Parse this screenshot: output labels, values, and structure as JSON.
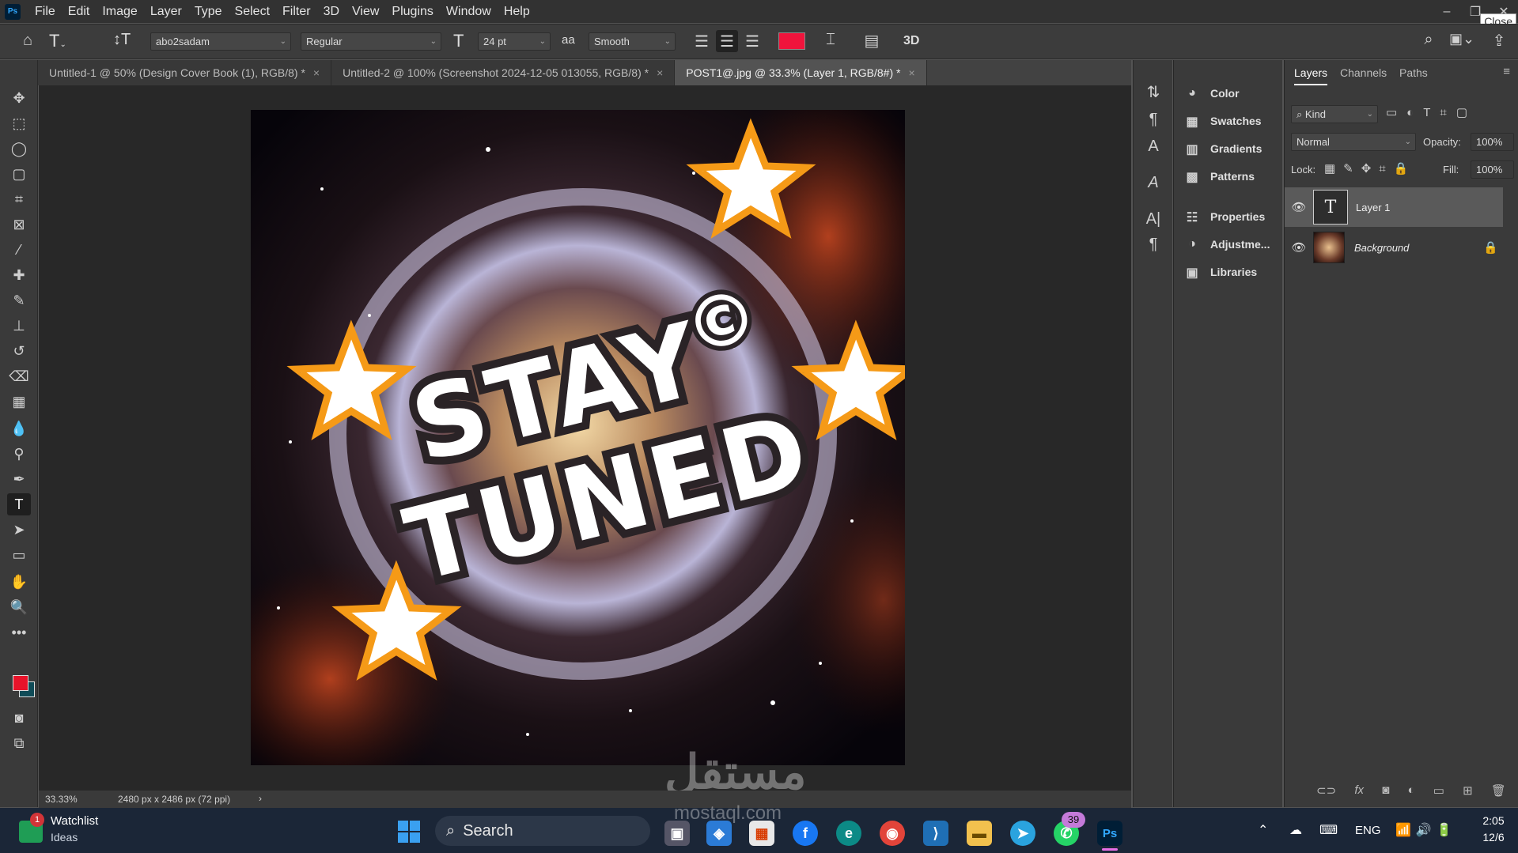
{
  "menubar": {
    "app_logo": "Ps",
    "items": [
      "File",
      "Edit",
      "Image",
      "Layer",
      "Type",
      "Select",
      "Filter",
      "3D",
      "View",
      "Plugins",
      "Window",
      "Help"
    ],
    "close_tooltip": "Close"
  },
  "options": {
    "font_family": "abo2sadam",
    "font_style": "Regular",
    "font_size": "24 pt",
    "antialias_label": "aa",
    "antialias": "Smooth",
    "text_color": "#f0143c",
    "threed_label": "3D"
  },
  "tabs": [
    {
      "label": "Untitled-1 @ 50% (Design Cover Book (1), RGB/8) *"
    },
    {
      "label": "Untitled-2 @ 100% (Screenshot 2024-12-05 013055, RGB/8) *"
    },
    {
      "label": "POST1@.jpg @ 33.3% (Layer 1, RGB/8#) *"
    }
  ],
  "canvas": {
    "headline_line1": "STAY",
    "headline_line2": "TUNED",
    "copyright_symbol": "©"
  },
  "status": {
    "zoom": "33.33%",
    "doc_info": "2480 px x 2486 px (72 ppi)",
    "arrow": "›"
  },
  "panels": {
    "items": [
      "Color",
      "Swatches",
      "Gradients",
      "Patterns",
      "Properties",
      "Adjustme...",
      "Libraries"
    ]
  },
  "layers": {
    "tabs": [
      "Layers",
      "Channels",
      "Paths"
    ],
    "filter_kind": "Kind",
    "blend_mode": "Normal",
    "opacity_label": "Opacity:",
    "opacity": "100%",
    "lock_label": "Lock:",
    "fill_label": "Fill:",
    "fill": "100%",
    "rows": [
      {
        "name": "Layer 1",
        "thumb": "T"
      },
      {
        "name": "Background"
      }
    ],
    "footer_fx": "fx"
  },
  "swatches": {
    "foreground": "#e8132a",
    "background": "#0f4b57"
  },
  "watermark": {
    "arabic": "مستقل",
    "latin": "mostaql.com"
  },
  "taskbar": {
    "watchlist_title": "Watchlist",
    "watchlist_sub": "Ideas",
    "watchlist_badge": "1",
    "search_label": "Search",
    "whatsapp_badge": "39",
    "language": "ENG",
    "time": "2:05",
    "date": "12/6",
    "ps_label": "Ps"
  }
}
